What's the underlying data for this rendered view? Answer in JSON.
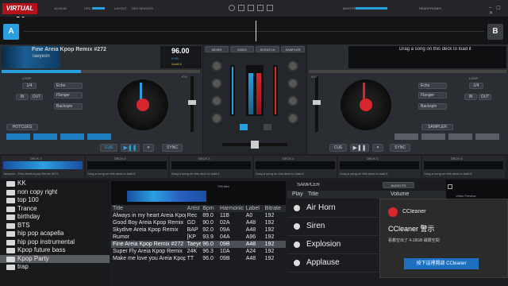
{
  "app": {
    "logo": "VIRTUAL DJ",
    "clock": "10:25:48",
    "cpu_label": "CPU",
    "layout_label": "LAYOUT",
    "layout_value": "DEV DEVICES",
    "master_label": "MASTER",
    "headphones_label": "HEADPHONES"
  },
  "deck_a": {
    "letter": "A",
    "title": "Fine Areia Kpop Remix #272",
    "artist": "Taeyeon",
    "bpm": "96.00",
    "pitch": "0.0%",
    "key": "2A48.6",
    "gain": "+0.0",
    "cue_label": "CUE",
    "sync_label": "SYNC",
    "loop_label": "LOOP",
    "loop_size": "1/4",
    "in_label": "IN",
    "out_label": "OUT",
    "pads_label": "HOTCUES",
    "effect_label": "Echo",
    "effect2": "Flanger",
    "effect3": "Backspin"
  },
  "deck_b": {
    "letter": "B",
    "drop_text": "Drag a song on this deck to load it",
    "gain": "+0.0",
    "cue_label": "CUE",
    "sync_label": "SYNC",
    "loop_label": "LOOP",
    "loop_size": "1/4",
    "in_label": "IN",
    "out_label": "OUT",
    "effect_label": "Echo",
    "effect2": "Flanger",
    "effect3": "Backspin",
    "sampler_label": "SAMPLER"
  },
  "mixer": {
    "tabs": [
      "MIXER",
      "VIDEO",
      "SCRATCH",
      "SAMPLER"
    ],
    "crossfader_label": "CROSSFADER"
  },
  "mini_decks": [
    {
      "label": "DECK 1",
      "text": "Taeyeon - Fine Areia Kpop Remix #272"
    },
    {
      "label": "DECK 2",
      "text": "Drag a song on this deck to load it"
    },
    {
      "label": "DECK 3",
      "text": "Drag a song on this deck to load it"
    },
    {
      "label": "DECK 4",
      "text": "Drag a song on this deck to load it"
    },
    {
      "label": "DECK 5",
      "text": "Drag a song on this deck to load it"
    },
    {
      "label": "DECK 6",
      "text": "Drag a song on this deck to load it"
    }
  ],
  "browser": {
    "folders": [
      "KK",
      "non copy right",
      "top 100",
      "Trance",
      "birthday",
      "BTS",
      "hip pop acapella",
      "hip pop instrumental",
      "Kpop future bass",
      "Kpop Party",
      "trap"
    ],
    "selected_folder": "Kpop Party",
    "columns": [
      "Title",
      "Artist",
      "Bpm",
      "Harmonic",
      "Label",
      "Bitrate"
    ],
    "rows": [
      [
        "Always in my heart Areia Kpop",
        "Rec",
        "89.0",
        "11B",
        "A0",
        "192"
      ],
      [
        "Good Boy Areia Kpop Remix",
        "GD",
        "90.0",
        "02A",
        "A48",
        "192"
      ],
      [
        "Skydive Areia Kpop Remix",
        "BAP",
        "92.0",
        "09A",
        "A48",
        "192"
      ],
      [
        "Rumor",
        "[KP",
        "93.9",
        "04A",
        "A96",
        "192"
      ],
      [
        "Fine Areia Kpop Remix #272",
        "Taeyeon",
        "96.0",
        "09B",
        "A48",
        "192"
      ],
      [
        "Super Fly Areia Kpop Remix",
        "24K",
        "96.3",
        "10A",
        "A24",
        "192"
      ],
      [
        "Make me love you Areia Kpop",
        "TT",
        "96.0",
        "09B",
        "A48",
        "192"
      ]
    ],
    "selected_row": 4,
    "waveform_label": "795 files"
  },
  "sampler": {
    "label": "SAMPLER",
    "bank": "AUDIO FX",
    "columns": [
      "Play",
      "Title",
      "Volume"
    ],
    "items": [
      "Air Horn",
      "Siren",
      "Explosion",
      "Applause"
    ]
  },
  "popup": {
    "app_name": "CCleaner",
    "title": "CCleaner 警示",
    "message": "看着空出了 4.18GB 磁碟空間",
    "button": "按下這裡開啟 CCleaner"
  },
  "video_preview": {
    "label": "Video Preview"
  },
  "colors": {
    "accent": "#2a9fe0",
    "red": "#d9262e",
    "popup_bg": "#2b2b2b",
    "popup_button": "#1e6fc0"
  }
}
